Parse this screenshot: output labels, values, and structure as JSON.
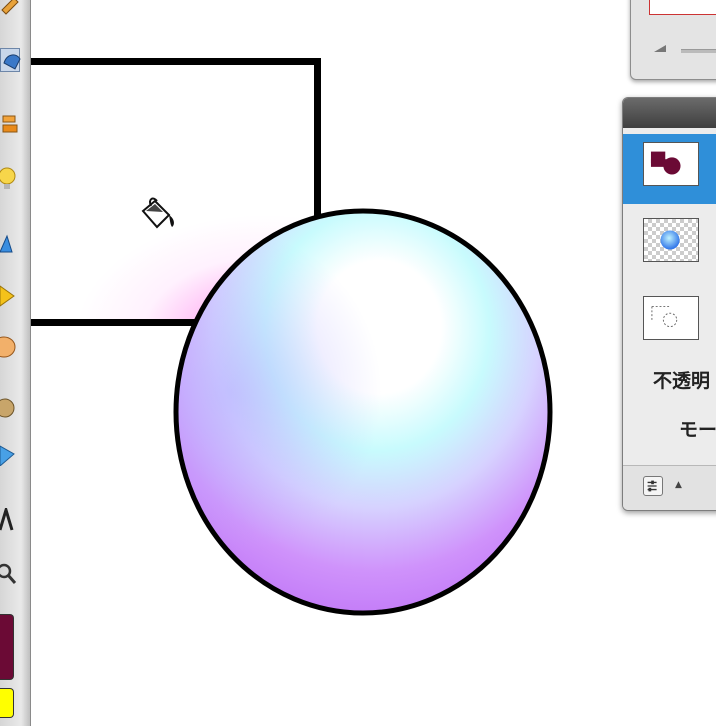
{
  "colors": {
    "foreground": "#6b0a35",
    "background": "#ffff00",
    "layer_selected": "#2f8fd9",
    "outline": "#000000"
  },
  "toolbar": {
    "tools": [
      "brush-icon",
      "selected-tool-icon",
      "layers-stack-icon",
      "lightbulb-icon",
      "triangle-shape-icon",
      "diamond-icon",
      "shell-icon",
      "blob-icon",
      "wing-icon",
      "text-tool-icon",
      "magnifier-icon"
    ]
  },
  "canvas": {
    "cursor_icon": "paint-bucket-icon"
  },
  "layers_panel": {
    "opacity_label": "不透明",
    "mode_label": "モー",
    "footer_icons": [
      "options-icon",
      "menu-triangle-icon"
    ],
    "footer_triangle": "▲"
  }
}
